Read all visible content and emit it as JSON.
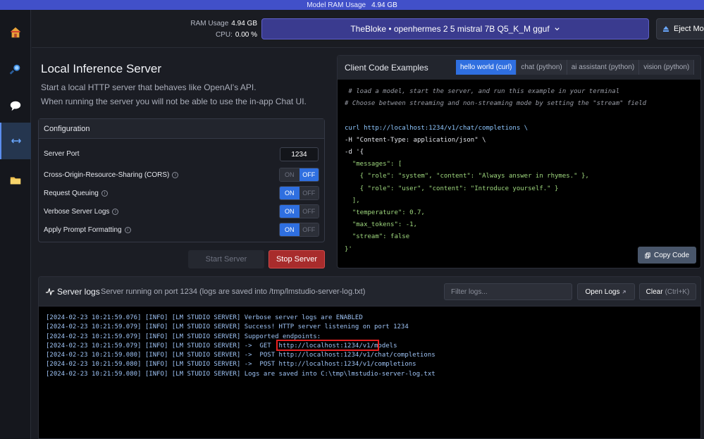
{
  "topbar": {
    "label": "Model RAM Usage",
    "value": "4.94 GB"
  },
  "sidebar": {
    "items": [
      {
        "name": "home",
        "icon": "home-icon"
      },
      {
        "name": "search",
        "icon": "search-icon"
      },
      {
        "name": "chat",
        "icon": "chat-icon"
      },
      {
        "name": "server",
        "icon": "server-arrows-icon",
        "active": true
      },
      {
        "name": "models",
        "icon": "folder-icon"
      }
    ]
  },
  "header": {
    "ram_label": "RAM Usage",
    "ram_value": "4.94 GB",
    "cpu_label": "CPU:",
    "cpu_value": "0.00 %",
    "model_name": "TheBloke • openhermes 2 5 mistral 7B Q5_K_M gguf",
    "eject_label": "Eject Mode"
  },
  "server": {
    "title": "Local Inference Server",
    "desc1": "Start a local HTTP server that behaves like OpenAI's API.",
    "desc2": "When running the server you will not be able to use the in-app Chat UI."
  },
  "config": {
    "heading": "Configuration",
    "port_label": "Server Port",
    "port_value": "1234",
    "cors_label": "Cross-Origin-Resource-Sharing (CORS)",
    "queuing_label": "Request Queuing",
    "verbose_label": "Verbose Server Logs",
    "prompt_label": "Apply Prompt Formatting",
    "on": "ON",
    "off": "OFF",
    "start_label": "Start Server",
    "stop_label": "Stop Server"
  },
  "code_panel": {
    "title": "Client Code Examples",
    "tabs": [
      "hello world (curl)",
      "chat (python)",
      "ai assistant (python)",
      "vision (python)"
    ],
    "copy_label": "Copy Code",
    "lines": [
      " # load a model, start the server, and run this example in your terminal",
      "# Choose between streaming and non-streaming mode by setting the \"stream\" field",
      "",
      "curl http://localhost:1234/v1/chat/completions \\",
      "-H \"Content-Type: application/json\" \\",
      "-d '{",
      "  \"messages\": [",
      "    { \"role\": \"system\", \"content\": \"Always answer in rhymes.\" },",
      "    { \"role\": \"user\", \"content\": \"Introduce yourself.\" }",
      "  ],",
      "  \"temperature\": 0.7,",
      "  \"max_tokens\": -1,",
      "  \"stream\": false",
      "}'"
    ]
  },
  "logs": {
    "title": "Server logs",
    "subtitle": "Server running on port 1234 (logs are saved into /tmp/lmstudio-server-log.txt)",
    "filter_placeholder": "Filter logs...",
    "open_label": "Open Logs",
    "clear_label": "Clear",
    "clear_shortcut": "(Ctrl+K)",
    "lines": [
      "[2024-02-23 10:21:59.076] [INFO] [LM STUDIO SERVER] Verbose server logs are ENABLED",
      "[2024-02-23 10:21:59.079] [INFO] [LM STUDIO SERVER] Success! HTTP server listening on port 1234",
      "[2024-02-23 10:21:59.079] [INFO] [LM STUDIO SERVER] Supported endpoints:",
      "[2024-02-23 10:21:59.079] [INFO] [LM STUDIO SERVER] ->  GET  http://localhost:1234/v1/models",
      "[2024-02-23 10:21:59.080] [INFO] [LM STUDIO SERVER] ->  POST http://localhost:1234/v1/chat/completions",
      "[2024-02-23 10:21:59.080] [INFO] [LM STUDIO SERVER] ->  POST http://localhost:1234/v1/completions",
      "[2024-02-23 10:21:59.080] [INFO] [LM STUDIO SERVER] Logs are saved into C:\\tmp\\lmstudio-server-log.txt"
    ]
  },
  "colors": {
    "accent": "#2f6fe0",
    "topbar": "#4150c9",
    "stop": "#a82c2c",
    "highlight": "#e82020"
  }
}
